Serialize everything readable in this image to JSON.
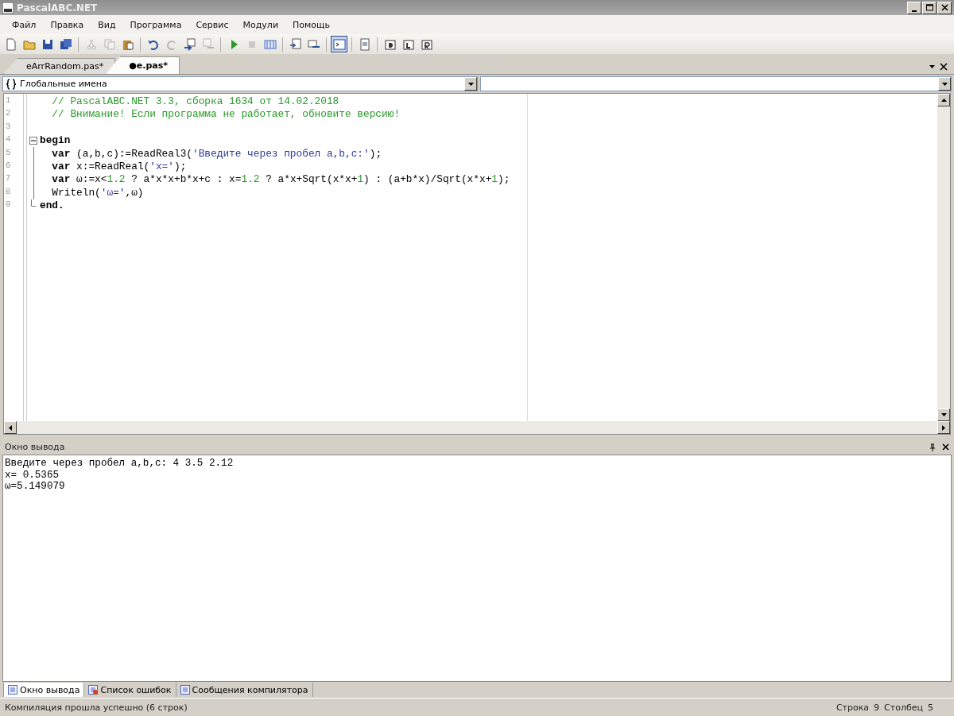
{
  "window": {
    "title": "PascalABC.NET"
  },
  "menu": [
    "Файл",
    "Правка",
    "Вид",
    "Программа",
    "Сервис",
    "Модули",
    "Помощь"
  ],
  "toolbar": [
    {
      "kind": "button",
      "disabled": false,
      "pressed": false
    },
    {
      "kind": "button",
      "disabled": false,
      "pressed": false
    },
    {
      "kind": "button",
      "disabled": false,
      "pressed": false
    },
    {
      "kind": "button",
      "disabled": false,
      "pressed": false
    },
    {
      "kind": "separator"
    },
    {
      "kind": "button",
      "disabled": true,
      "pressed": false
    },
    {
      "kind": "button",
      "disabled": true,
      "pressed": false
    },
    {
      "kind": "button",
      "disabled": false,
      "pressed": false
    },
    {
      "kind": "separator"
    },
    {
      "kind": "button",
      "disabled": false,
      "pressed": false
    },
    {
      "kind": "button",
      "disabled": true,
      "pressed": false
    },
    {
      "kind": "button",
      "disabled": false,
      "pressed": false
    },
    {
      "kind": "button",
      "disabled": true,
      "pressed": false
    },
    {
      "kind": "separator"
    },
    {
      "kind": "button",
      "disabled": false,
      "pressed": false
    },
    {
      "kind": "button",
      "disabled": true,
      "pressed": false
    },
    {
      "kind": "button",
      "disabled": false,
      "pressed": false
    },
    {
      "kind": "separator"
    },
    {
      "kind": "button",
      "disabled": false,
      "pressed": false
    },
    {
      "kind": "button",
      "disabled": false,
      "pressed": false
    },
    {
      "kind": "separator"
    },
    {
      "kind": "button",
      "disabled": false,
      "pressed": true
    },
    {
      "kind": "separator"
    },
    {
      "kind": "button",
      "disabled": false,
      "pressed": false
    },
    {
      "kind": "separator"
    },
    {
      "kind": "button",
      "disabled": false,
      "pressed": false
    },
    {
      "kind": "button",
      "disabled": false,
      "pressed": false
    },
    {
      "kind": "button",
      "disabled": false,
      "pressed": false
    }
  ],
  "tabs": [
    {
      "label": "eArrRandom.pas*",
      "selected": false
    },
    {
      "label": "●e.pas*",
      "selected": true
    }
  ],
  "scope_selector": {
    "value": "Глобальные имена"
  },
  "editor": {
    "lines": [
      {
        "number": "1",
        "kind": "plain",
        "tokens": [
          {
            "kind": "comment",
            "text": "  // PascalABC.NET 3.3, сборка 1634 от 14.02.2018"
          }
        ]
      },
      {
        "number": "2",
        "kind": "plain",
        "tokens": [
          {
            "kind": "comment",
            "text": "  // Внимание! Если программа не работает, обновите версию!"
          }
        ]
      },
      {
        "number": "3",
        "kind": "plain"
      },
      {
        "number": "4",
        "kind": "fold_start",
        "tokens": [
          {
            "kind": "keyword",
            "text": "begin"
          }
        ]
      },
      {
        "number": "5",
        "kind": "fold_body",
        "tokens": [
          {
            "kind": "keyword",
            "text": "  var"
          },
          {
            "kind": "plain",
            "text": " (a,b,c):=ReadReal3("
          },
          {
            "kind": "string",
            "text": "'Введите через пробел a,b,c:'"
          },
          {
            "kind": "plain",
            "text": ");"
          }
        ]
      },
      {
        "number": "6",
        "kind": "fold_body",
        "tokens": [
          {
            "kind": "keyword",
            "text": "  var"
          },
          {
            "kind": "plain",
            "text": " x:=ReadReal("
          },
          {
            "kind": "string",
            "text": "'x='"
          },
          {
            "kind": "plain",
            "text": ");"
          }
        ]
      },
      {
        "number": "7",
        "kind": "fold_body",
        "tokens": [
          {
            "kind": "keyword",
            "text": "  var"
          },
          {
            "kind": "plain",
            "text": " ω:=x<"
          },
          {
            "kind": "number",
            "text": "1.2"
          },
          {
            "kind": "plain",
            "text": " ? a*x*x+b*x+c : x="
          },
          {
            "kind": "number",
            "text": "1.2"
          },
          {
            "kind": "plain",
            "text": " ? a*x+Sqrt(x*x+"
          },
          {
            "kind": "number",
            "text": "1"
          },
          {
            "kind": "plain",
            "text": ") : (a+b*x)/Sqrt(x*x+"
          },
          {
            "kind": "number",
            "text": "1"
          },
          {
            "kind": "plain",
            "text": ");"
          }
        ]
      },
      {
        "number": "8",
        "kind": "fold_body",
        "tokens": [
          {
            "kind": "plain",
            "text": "  Writeln("
          },
          {
            "kind": "string",
            "text": "'ω='"
          },
          {
            "kind": "plain",
            "text": ",ω)"
          }
        ]
      },
      {
        "number": "9",
        "kind": "fold_end",
        "tokens": [
          {
            "kind": "keyword",
            "text": "end."
          }
        ]
      }
    ]
  },
  "output_panel": {
    "title": "Окно вывода",
    "lines": [
      "Введите через пробел a,b,c: 4 3.5 2.12",
      "x= 0.5365",
      "ω=5.149079"
    ]
  },
  "bottom_tabs": [
    {
      "label": "Окно вывода",
      "selected": true
    },
    {
      "label": "Список ошибок",
      "selected": false
    },
    {
      "label": "Сообщения компилятора",
      "selected": false
    }
  ],
  "status_bar": {
    "message": "Компиляция прошла успешно (6 строк)",
    "line_label": "Строка",
    "line": "9",
    "column_label": "Столбец",
    "column": "5"
  }
}
